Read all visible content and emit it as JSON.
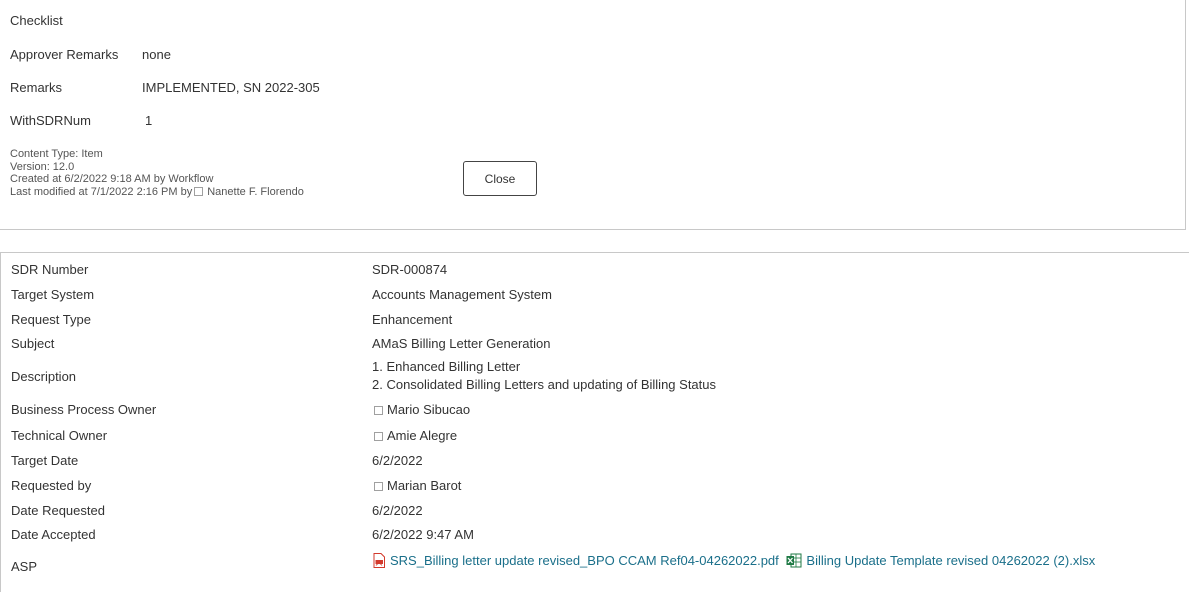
{
  "top": {
    "checklist_label": "Checklist",
    "approver_remarks_label": "Approver Remarks",
    "approver_remarks_value": "none",
    "remarks_label": "Remarks",
    "remarks_value": "IMPLEMENTED, SN 2022-305",
    "withsdrnum_label": "WithSDRNum",
    "withsdrnum_value": "1",
    "content_type": "Content Type: Item",
    "version": "Version: 12.0",
    "created": "Created at 6/2/2022 9:18 AM  by Workflow",
    "modified_prefix": "Last modified at 7/1/2022 2:16 PM  by",
    "modified_by": "Nanette F. Florendo",
    "close_label": "Close"
  },
  "details": {
    "sdr_number_label": "SDR Number",
    "sdr_number_value": "SDR-000874",
    "target_system_label": "Target System",
    "target_system_value": "Accounts Management System",
    "request_type_label": "Request Type",
    "request_type_value": "Enhancement",
    "subject_label": "Subject",
    "subject_value": "AMaS Billing Letter Generation",
    "description_label": "Description",
    "description_line1": "1. Enhanced Billing Letter",
    "description_line2": "2. Consolidated Billing Letters and updating of Billing Status",
    "bpo_label": "Business Process Owner",
    "bpo_value": "Mario Sibucao",
    "technical_owner_label": "Technical Owner",
    "technical_owner_value": "Amie Alegre",
    "target_date_label": "Target Date",
    "target_date_value": "6/2/2022",
    "requested_by_label": "Requested by",
    "requested_by_value": "Marian Barot",
    "date_requested_label": "Date Requested",
    "date_requested_value": "6/2/2022",
    "date_accepted_label": "Date Accepted",
    "date_accepted_value": "6/2/2022 9:47 AM",
    "asp_label": "ASP",
    "asp_file1": "SRS_Billing letter update revised_BPO CCAM Ref04-04262022.pdf",
    "asp_file2": "Billing Update Template revised 04262022 (2).xlsx"
  },
  "colors": {
    "link": "#1a6f8a",
    "pdf_icon": "#d33a2c",
    "xlsx_icon": "#1f7a45"
  },
  "icons": [
    "presence-icon",
    "pdf-file-icon",
    "excel-file-icon"
  ]
}
